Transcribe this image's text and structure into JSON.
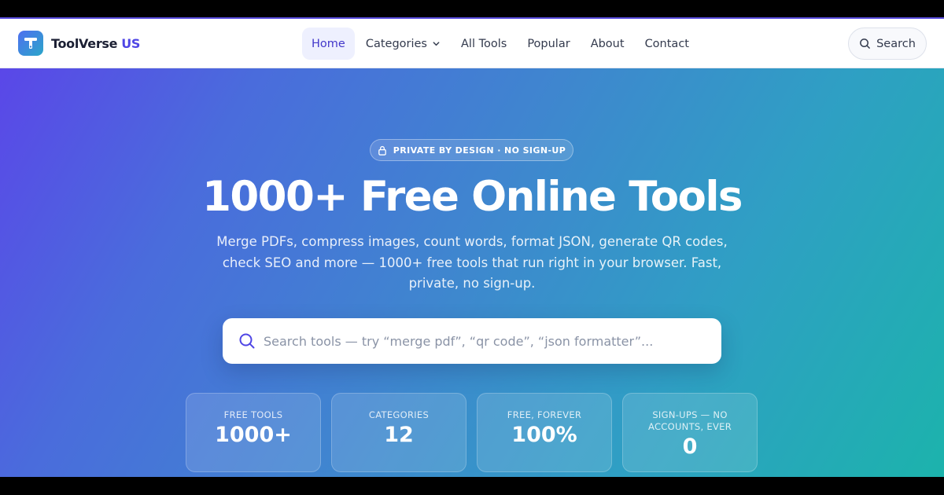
{
  "brand": {
    "name": "ToolVerse",
    "accent": "US",
    "accent_color": "#4f46e5",
    "logo_icon": "tool-t-icon"
  },
  "nav": {
    "items": [
      {
        "label": "Home",
        "active": true
      },
      {
        "label": "Categories",
        "has_dropdown": true
      },
      {
        "label": "All Tools"
      },
      {
        "label": "Popular"
      },
      {
        "label": "About"
      },
      {
        "label": "Contact"
      }
    ],
    "search_label": "Search"
  },
  "hero": {
    "badge": "PRIVATE BY DESIGN · NO SIGN-UP",
    "badge_icon": "lock-icon",
    "title": "1000+ Free Online Tools",
    "subtitle": "Merge PDFs, compress images, count words, format JSON, generate QR codes, check SEO and more — 1000+ free tools that run right in your browser. Fast, private, no sign-up.",
    "search_placeholder": "Search tools — try “merge pdf”, “qr code”, “json formatter”...",
    "search_value": ""
  },
  "stats": [
    {
      "label": "FREE TOOLS",
      "value": "1000+"
    },
    {
      "label": "CATEGORIES",
      "value": "12"
    },
    {
      "label": "FREE, FOREVER",
      "value": "100%"
    },
    {
      "label": "SIGN-UPS — NO ACCOUNTS, EVER",
      "value": "0"
    }
  ],
  "colors": {
    "gradient_start": "#5a47e8",
    "gradient_end": "#1cb3ac",
    "nav_active_bg": "#eef0fe",
    "nav_active_text": "#4338ca"
  }
}
